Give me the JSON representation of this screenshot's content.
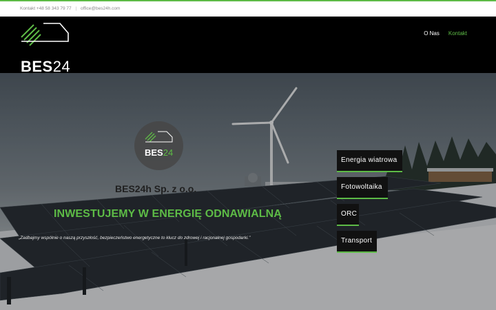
{
  "topbar": {
    "phone": "Kontakt +48 58 343 79 77",
    "separator": "|",
    "email": "office@bes24h.com"
  },
  "brand": {
    "logo_letters": "BES",
    "logo_number": "24"
  },
  "nav": {
    "items": [
      "O Nas",
      "Kontakt"
    ],
    "active": "Kontakt"
  },
  "hero": {
    "company": "BES24h Sp. z o.o.",
    "headline": "INWESTUJEMY W ENERGIĘ ODNAWIALNĄ",
    "quote": "„Zadbajmy wspólnie o naszą przyszłość, bezpieczeństwo energetyczne to klucz do zdrowej i racjonalnej gospodarki.”"
  },
  "menu": {
    "items": [
      "Energia wiatrowa",
      "Fotowoltaika",
      "ORC",
      "Transport"
    ]
  },
  "colors": {
    "accent": "#5dbb46",
    "header_bg": "#000000",
    "menu_bg": "#111111"
  }
}
